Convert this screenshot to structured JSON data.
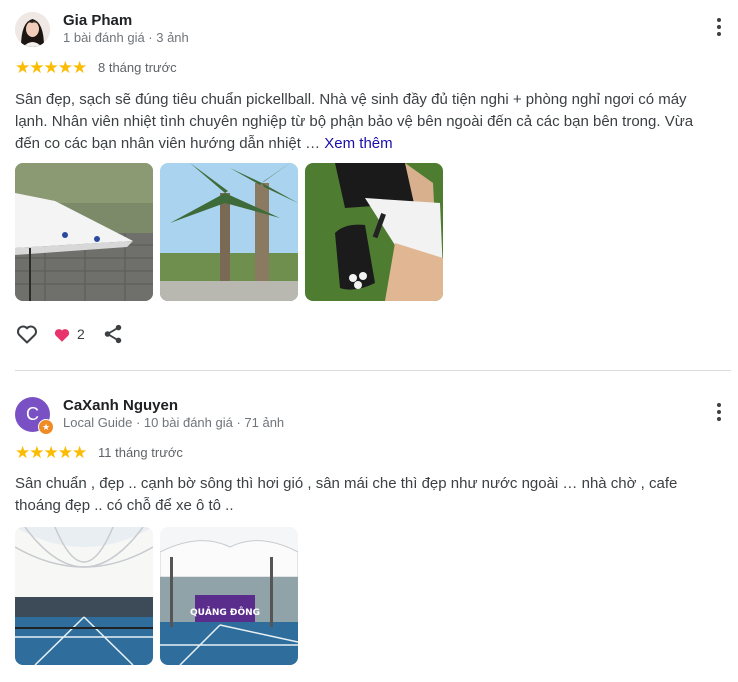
{
  "reviews": [
    {
      "author": "Gia Pham",
      "meta": "1 bài đánh giá · 3 ảnh",
      "rating": 5,
      "time": "8 tháng trước",
      "text": "Sân đẹp, sạch sẽ đúng tiêu chuẩn pickellball. Nhà vệ sinh đầy đủ tiện nghi + phòng nghỉ ngơi có máy lạnh. Nhân viên nhiệt tình chuyên nghiệp từ bộ phận bảo vệ bên ngoài đến cả các bạn bên trong. Vừa đến co các bạn nhân viên hướng dẫn nhiệt … ",
      "see_more": "Xem thêm",
      "reaction_count": "2",
      "icons": [
        "avatar-photo",
        "more-vert-icon",
        "star-icon",
        "heart-outline-icon",
        "heart-filled-icon",
        "share-icon"
      ]
    },
    {
      "author": "CaXanh Nguyen",
      "avatar_letter": "C",
      "meta": "Local Guide · 10 bài đánh giá · 71 ảnh",
      "rating": 5,
      "time": "11 tháng trước",
      "text": "Sân chuẩn , đẹp .. cạnh bờ sông thì hơi gió , sân mái che thì đẹp như nước ngoài … nhà chờ , cafe thoáng đẹp .. có chỗ để xe ô tô ..",
      "banner_text": "QUẢNG ĐÔNG",
      "icons": [
        "local-guide-badge-icon",
        "more-vert-icon",
        "star-icon"
      ]
    }
  ],
  "colors": {
    "star": "#fbbc04",
    "link": "#1a0dab",
    "heart": "#e8336d",
    "avatar2": "#7a51c4"
  }
}
